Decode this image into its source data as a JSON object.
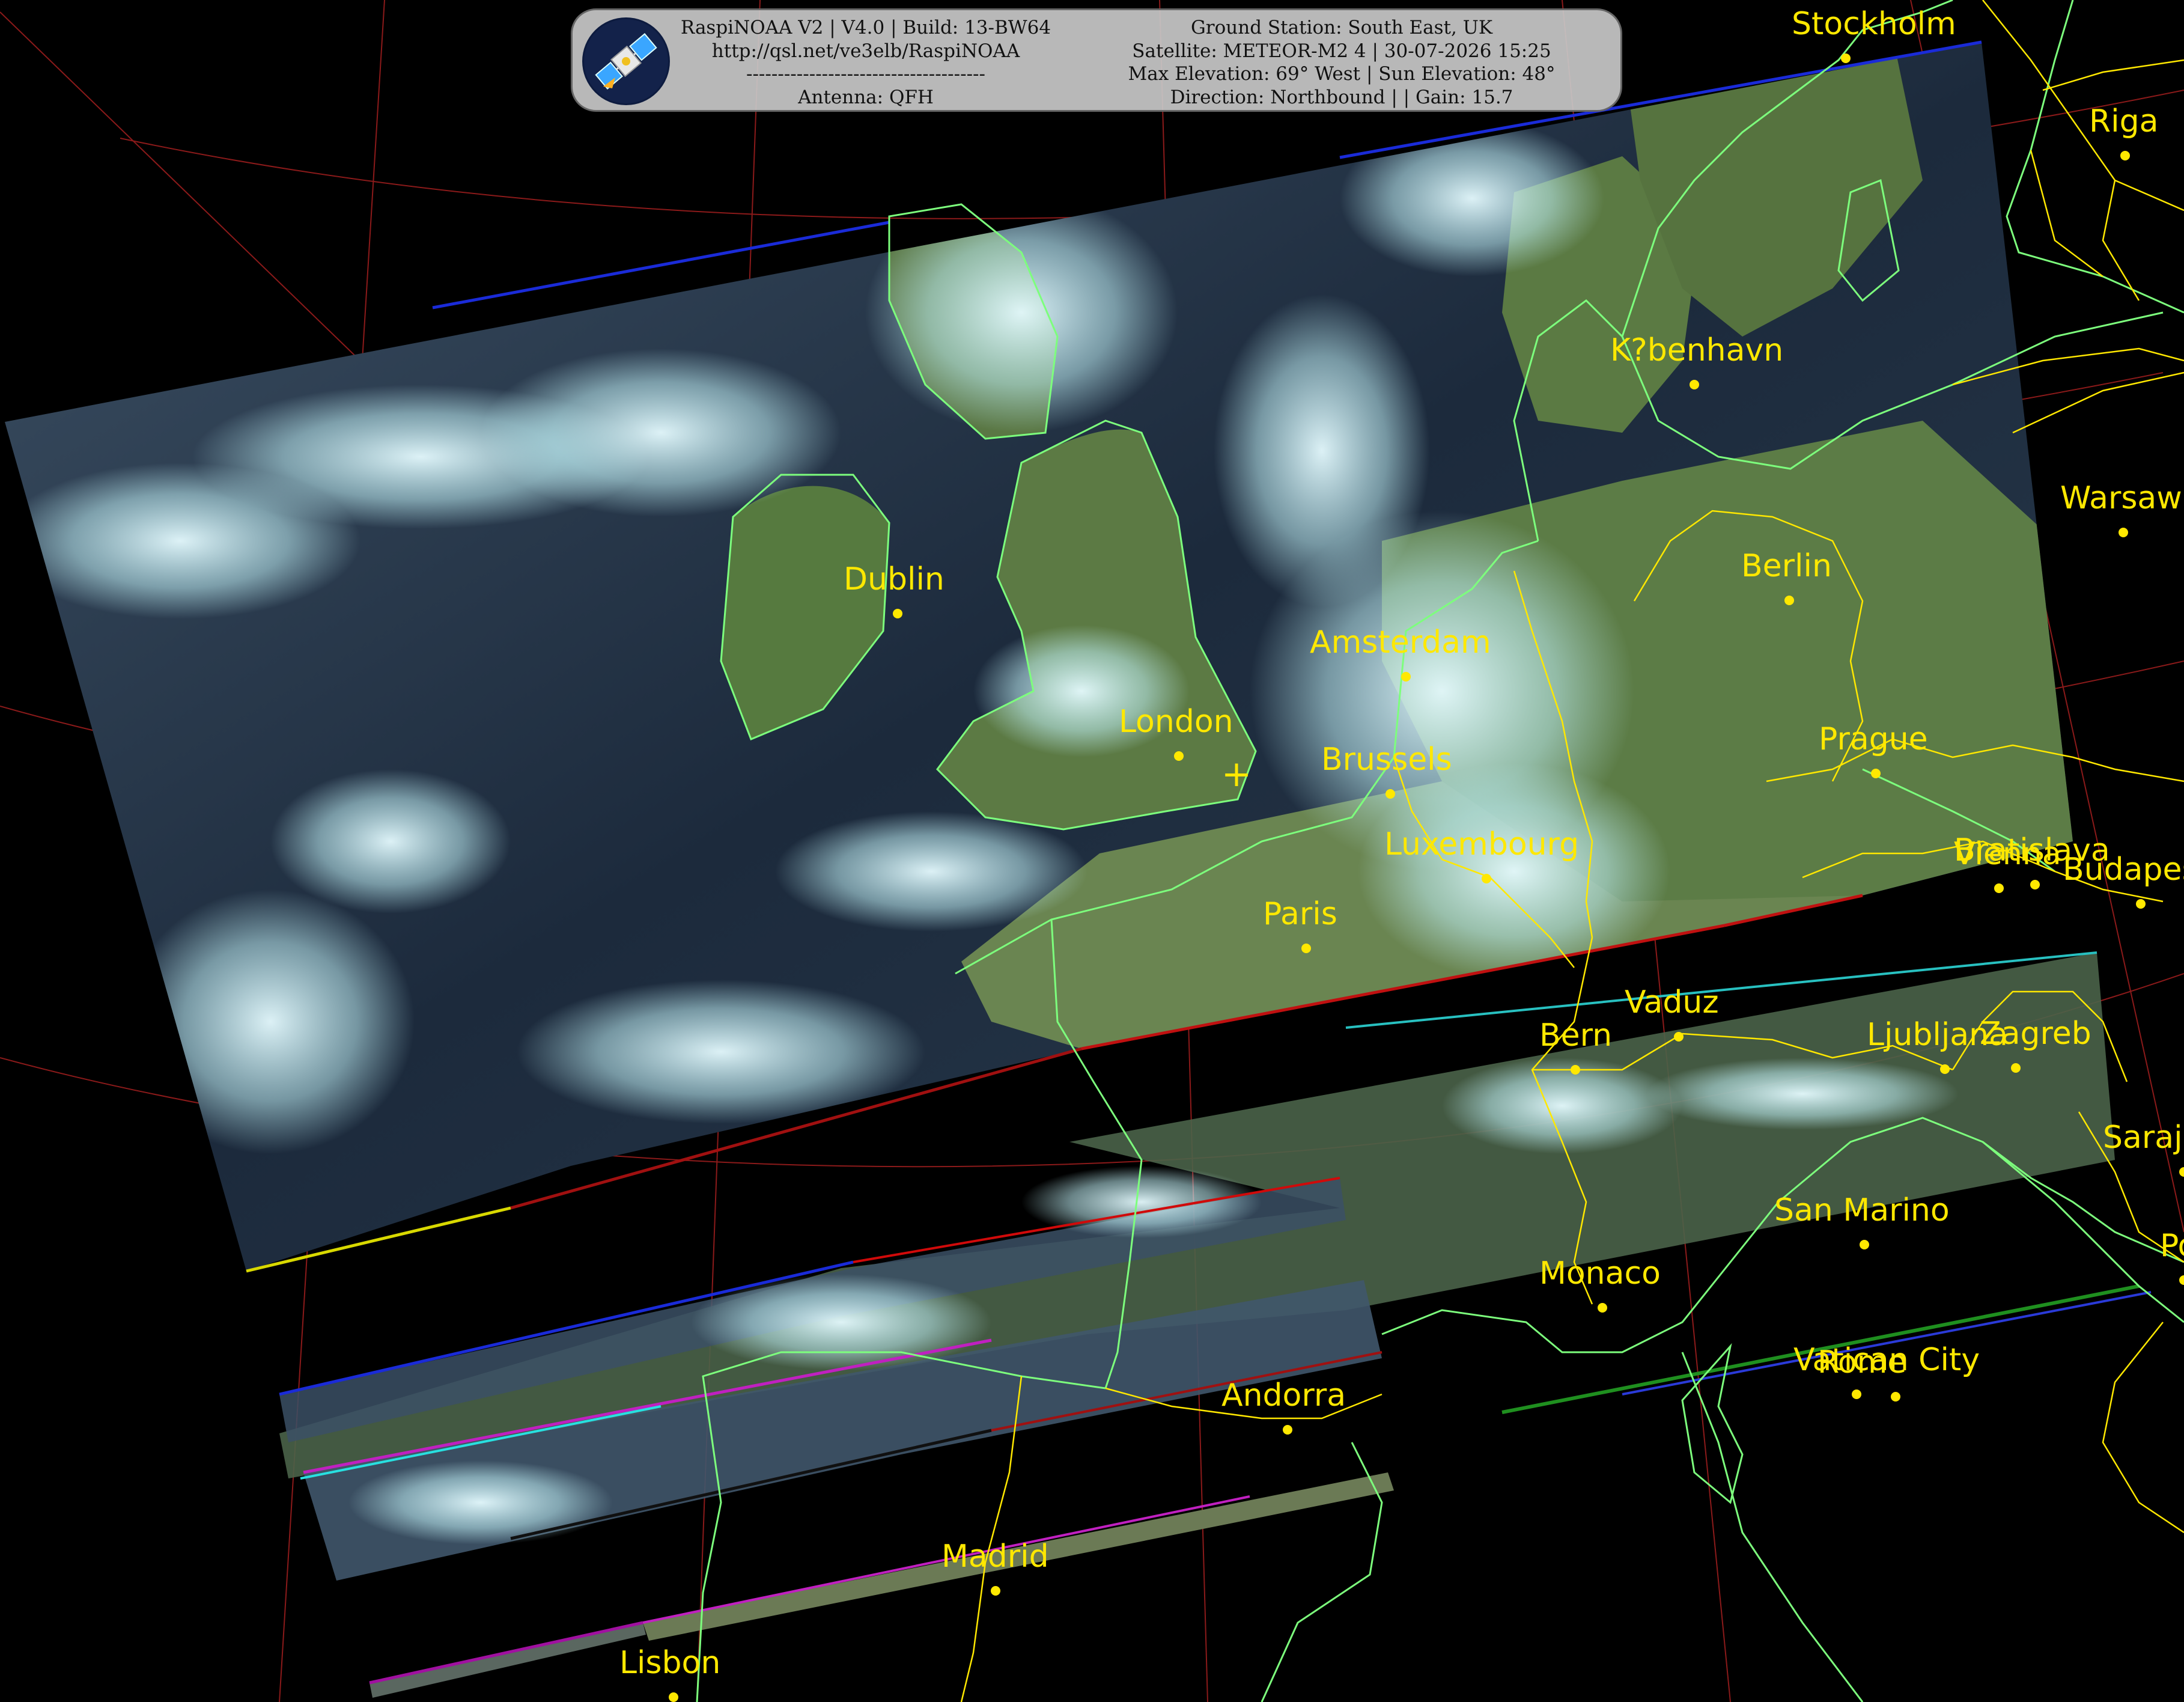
{
  "header": {
    "app_line": "RaspiNOAA V2 | V4.0 | Build: 13-BW64",
    "url_line": "http://qsl.net/ve3elb/RaspiNOAA",
    "separator": "--------------------------------------",
    "antenna_line": "Antenna: QFH",
    "station_line": "Ground Station: South East, UK",
    "satellite_line": "Satellite: METEOR-M2 4 | 30-07-2026 15:25",
    "elevation_line": "Max Elevation: 69° West | Sun Elevation: 48°",
    "direction_line": "Direction: Northbound | | Gain: 15.7",
    "logo_icon": "satellite-icon"
  },
  "cities": [
    {
      "name": "Stockholm"
    },
    {
      "name": "Riga"
    },
    {
      "name": "K?benhavn"
    },
    {
      "name": "Warsaw"
    },
    {
      "name": "Dublin"
    },
    {
      "name": "Berlin"
    },
    {
      "name": "Amsterdam"
    },
    {
      "name": "London"
    },
    {
      "name": "Brussels"
    },
    {
      "name": "Prague"
    },
    {
      "name": "Luxembourg"
    },
    {
      "name": "Bratislava"
    },
    {
      "name": "Vienna"
    },
    {
      "name": "Budapest"
    },
    {
      "name": "Paris"
    },
    {
      "name": "Vaduz"
    },
    {
      "name": "Bern"
    },
    {
      "name": "Ljubljana"
    },
    {
      "name": "Zagreb"
    },
    {
      "name": "Sarajevo"
    },
    {
      "name": "San Marino"
    },
    {
      "name": "Monaco"
    },
    {
      "name": "Vatican City"
    },
    {
      "name": "Rome"
    },
    {
      "name": "Andorra"
    },
    {
      "name": "Madrid"
    },
    {
      "name": "Lisbon"
    },
    {
      "name": "Podgorica"
    }
  ],
  "ground_station_marker": "+",
  "colors": {
    "background": "#000000",
    "coastline": "#7dff7d",
    "border": "#ffe800",
    "graticule": "#8b1a1a",
    "city": "#ffe800",
    "ocean": "#1a2838",
    "land": "#5d7a45",
    "cloud": "#d8f4f8"
  }
}
